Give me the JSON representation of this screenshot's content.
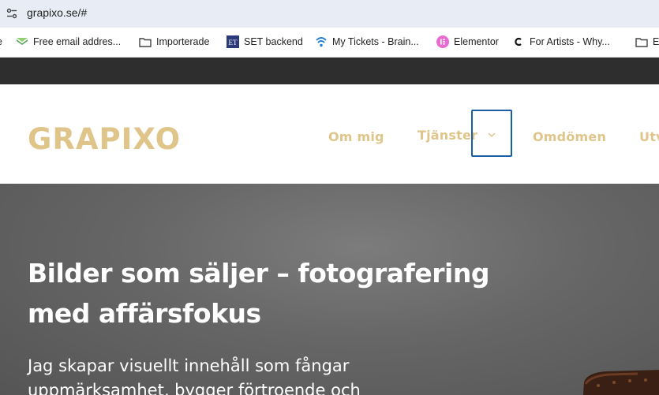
{
  "browser": {
    "url": "grapixo.se/#"
  },
  "bookmarks": [
    {
      "label": "e",
      "icon": "partial-bookmark-icon"
    },
    {
      "label": "Free email addres...",
      "icon": "mail-icon"
    },
    {
      "label": "Importerade",
      "icon": "folder-icon"
    },
    {
      "label": "SET backend",
      "icon": "et-logo-icon"
    },
    {
      "label": "My Tickets - Brain...",
      "icon": "wifi-logo-icon"
    },
    {
      "label": "Elementor",
      "icon": "elementor-icon"
    },
    {
      "label": "For Artists - Why...",
      "icon": "c-logo-icon"
    },
    {
      "label": "E",
      "icon": "folder-icon"
    }
  ],
  "header": {
    "logo_text": "GRAPIXO",
    "nav": {
      "om_mig": "Om mig",
      "tjanster": "Tjänster",
      "omdomen": "Omdömen",
      "utv": "Utv"
    }
  },
  "hero": {
    "title_line1": "Bilder som säljer – fotografering",
    "title_line2": "med affärsfokus",
    "subtitle_line1": "Jag skapar visuellt innehåll som fångar",
    "subtitle_line2": "uppmärksamhet, bygger förtroende och"
  },
  "colors": {
    "accent_gold": "#dfc58a",
    "focus_blue": "#1a5fa5",
    "dark_strip": "#2e2e2e"
  }
}
